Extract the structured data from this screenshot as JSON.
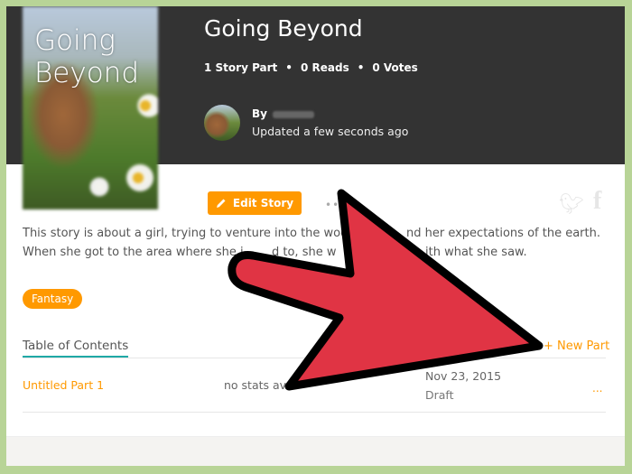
{
  "story": {
    "cover_title_line1": "Going",
    "cover_title_line2": "Beyond",
    "title": "Going Beyond",
    "stats": {
      "parts": "1 Story Part",
      "reads": "0 Reads",
      "votes": "0 Votes",
      "separator": "•"
    },
    "author_prefix": "By",
    "updated": "Updated a few seconds ago",
    "edit_label": "Edit Story",
    "more_label": "•••",
    "description_fragments": [
      "This story is about a girl, trying to venture into the wood",
      "nd her expectations of the earth.",
      "When she got to the area where she i",
      "d to, she w",
      "ith what she saw."
    ],
    "tag": "Fantasy"
  },
  "toc": {
    "heading": "Table of Contents",
    "new_part_label": "+ New Part",
    "parts": [
      {
        "title": "Untitled Part 1",
        "stats": "no stats ava",
        "date": "Nov 23, 2015",
        "status": "Draft",
        "more": "..."
      }
    ]
  },
  "icons": {
    "edit": "pencil-icon",
    "twitter": "twitter-icon",
    "facebook": "facebook-icon",
    "overlay": "red-arrow"
  },
  "colors": {
    "accent": "#ff9900",
    "header_bg": "#333333",
    "toc_underline": "#1fa9a6",
    "arrow": "#e03444",
    "frame": "#b8d497"
  }
}
